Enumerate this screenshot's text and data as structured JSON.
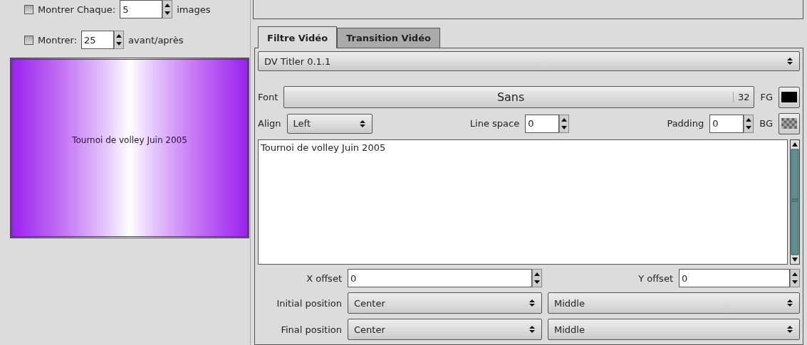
{
  "options": [
    {
      "label": "Montrer Chaque:",
      "checked": false,
      "value": "5",
      "suffix": "images"
    },
    {
      "label": "Montrer:",
      "checked": false,
      "value": "25",
      "suffix": "avant/après"
    }
  ],
  "preview": {
    "text": "Tournoi de volley Juin 2005"
  },
  "tabs": [
    {
      "label": "Filtre Vidéo",
      "selected": true
    },
    {
      "label": "Transition Vidéo",
      "selected": false
    }
  ],
  "filter": "DV Titler 0.1.1",
  "font": {
    "label": "Font",
    "name": "Sans",
    "size": "32",
    "fg_label": "FG"
  },
  "align": {
    "label": "Align",
    "value": "Left"
  },
  "line_space": {
    "label": "Line space",
    "value": "0"
  },
  "padding": {
    "label": "Padding",
    "value": "0"
  },
  "bg_label": "BG",
  "text": "Tournoi de volley Juin 2005",
  "x_offset": {
    "label": "X offset",
    "value": "0"
  },
  "y_offset": {
    "label": "Y offset",
    "value": "0"
  },
  "positions": [
    {
      "label": "Initial position",
      "horizontal": "Center",
      "vertical": "Middle"
    },
    {
      "label": "Final position",
      "horizontal": "Center",
      "vertical": "Middle"
    }
  ]
}
